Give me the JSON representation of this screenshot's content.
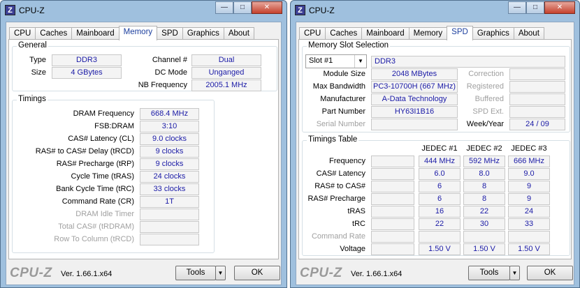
{
  "win1": {
    "title": "CPU-Z",
    "icon": "Z",
    "tabs": [
      {
        "label": "CPU"
      },
      {
        "label": "Caches"
      },
      {
        "label": "Mainboard"
      },
      {
        "label": "Memory"
      },
      {
        "label": "SPD"
      },
      {
        "label": "Graphics"
      },
      {
        "label": "About"
      }
    ],
    "active_tab": "Memory",
    "general": {
      "title": "General",
      "type_label": "Type",
      "type_value": "DDR3",
      "size_label": "Size",
      "size_value": "4 GBytes",
      "channel_label": "Channel #",
      "channel_value": "Dual",
      "dcmode_label": "DC Mode",
      "dcmode_value": "Unganged",
      "nbfreq_label": "NB Frequency",
      "nbfreq_value": "2005.1 MHz"
    },
    "timings": {
      "title": "Timings",
      "rows": [
        {
          "label": "DRAM Frequency",
          "value": "668.4 MHz",
          "enabled": true
        },
        {
          "label": "FSB:DRAM",
          "value": "3:10",
          "enabled": true
        },
        {
          "label": "CAS# Latency (CL)",
          "value": "9.0 clocks",
          "enabled": true
        },
        {
          "label": "RAS# to CAS# Delay (tRCD)",
          "value": "9 clocks",
          "enabled": true
        },
        {
          "label": "RAS# Precharge (tRP)",
          "value": "9 clocks",
          "enabled": true
        },
        {
          "label": "Cycle Time (tRAS)",
          "value": "24 clocks",
          "enabled": true
        },
        {
          "label": "Bank Cycle Time (tRC)",
          "value": "33 clocks",
          "enabled": true
        },
        {
          "label": "Command Rate (CR)",
          "value": "1T",
          "enabled": true
        },
        {
          "label": "DRAM Idle Timer",
          "value": "",
          "enabled": false
        },
        {
          "label": "Total CAS# (tRDRAM)",
          "value": "",
          "enabled": false
        },
        {
          "label": "Row To Column (tRCD)",
          "value": "",
          "enabled": false
        }
      ]
    },
    "footer": {
      "logo": "CPU-Z",
      "version": "Ver. 1.66.1.x64",
      "tools_label": "Tools",
      "ok_label": "OK"
    }
  },
  "win2": {
    "title": "CPU-Z",
    "icon": "Z",
    "tabs": [
      {
        "label": "CPU"
      },
      {
        "label": "Caches"
      },
      {
        "label": "Mainboard"
      },
      {
        "label": "Memory"
      },
      {
        "label": "SPD"
      },
      {
        "label": "Graphics"
      },
      {
        "label": "About"
      }
    ],
    "active_tab": "SPD",
    "slot": {
      "title": "Memory Slot Selection",
      "selected_slot": "Slot #1",
      "type_value": "DDR3",
      "module_size_label": "Module Size",
      "module_size": "2048 MBytes",
      "max_bw_label": "Max Bandwidth",
      "max_bw": "PC3-10700H (667 MHz)",
      "manufacturer_label": "Manufacturer",
      "manufacturer": "A-Data Technology",
      "part_label": "Part Number",
      "part": "HY63I1B16",
      "serial_label": "Serial Number",
      "serial": "",
      "correction_label": "Correction",
      "correction": "",
      "registered_label": "Registered",
      "registered": "",
      "buffered_label": "Buffered",
      "buffered": "",
      "spdext_label": "SPD Ext.",
      "spdext": "",
      "weekyear_label": "Week/Year",
      "weekyear": "24 / 09"
    },
    "table": {
      "title": "Timings Table",
      "columns": [
        "JEDEC #1",
        "JEDEC #2",
        "JEDEC #3"
      ],
      "rows": [
        {
          "label": "Frequency",
          "enabled": true,
          "values": [
            "444 MHz",
            "592 MHz",
            "666 MHz"
          ]
        },
        {
          "label": "CAS# Latency",
          "enabled": true,
          "values": [
            "6.0",
            "8.0",
            "9.0"
          ]
        },
        {
          "label": "RAS# to CAS#",
          "enabled": true,
          "values": [
            "6",
            "8",
            "9"
          ]
        },
        {
          "label": "RAS# Precharge",
          "enabled": true,
          "values": [
            "6",
            "8",
            "9"
          ]
        },
        {
          "label": "tRAS",
          "enabled": true,
          "values": [
            "16",
            "22",
            "24"
          ]
        },
        {
          "label": "tRC",
          "enabled": true,
          "values": [
            "22",
            "30",
            "33"
          ]
        },
        {
          "label": "Command Rate",
          "enabled": false,
          "values": [
            "",
            "",
            ""
          ]
        },
        {
          "label": "Voltage",
          "enabled": true,
          "values": [
            "1.50 V",
            "1.50 V",
            "1.50 V"
          ]
        }
      ]
    },
    "footer": {
      "logo": "CPU-Z",
      "version": "Ver. 1.66.1.x64",
      "tools_label": "Tools",
      "ok_label": "OK"
    }
  }
}
